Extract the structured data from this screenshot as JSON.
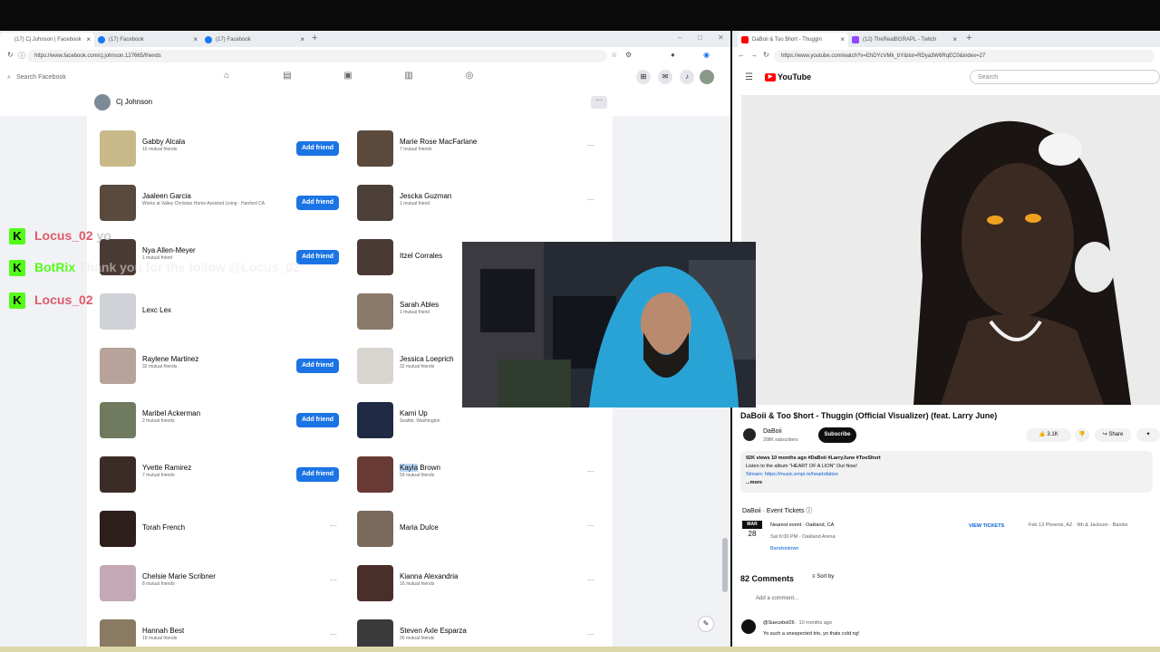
{
  "fb_window": {
    "tabs": [
      {
        "title": "(17) Cj Johnson | Facebook"
      },
      {
        "title": "(17) Facebook"
      },
      {
        "title": "(17) Facebook"
      }
    ],
    "url": "https://www.facebook.com/cj.johnson.127665/friends",
    "search_placeholder": "Search Facebook",
    "profile_name": "Cj Johnson",
    "profile_more": "···",
    "friends_left": [
      {
        "name": "Gabby Alcala",
        "sub": "16 mutual friends",
        "action": "Add friend",
        "color": "#c9b98a"
      },
      {
        "name": "Jaaleen Garcia",
        "sub": "Works at Valley Christian Home Assisted Living · Hanford CA",
        "action": "Add friend",
        "color": "#5a4a3e"
      },
      {
        "name": "Nya Allen-Meyer",
        "sub": "1 mutual friend",
        "action": "Add friend",
        "color": "#4a3a34"
      },
      {
        "name": "Lexc Lex",
        "sub": "",
        "action": "",
        "color": "#cfd2d6"
      },
      {
        "name": "Raylene Martinez",
        "sub": "32 mutual friends",
        "action": "Add friend",
        "color": "#b8a39a"
      },
      {
        "name": "Maribel Ackerman",
        "sub": "2 mutual friends",
        "action": "Add friend",
        "color": "#6f7a5e"
      },
      {
        "name": "Yvette Ramirez",
        "sub": "7 mutual friends",
        "action": "Add friend",
        "color": "#3c2c28"
      },
      {
        "name": "Torah French",
        "sub": "",
        "action": "···",
        "color": "#2e1e1c"
      },
      {
        "name": "Chelsie Marie Scribner",
        "sub": "8 mutual friends",
        "action": "···",
        "color": "#c4a8b5"
      },
      {
        "name": "Hannah Best",
        "sub": "19 mutual friends",
        "action": "···",
        "color": "#8a7a62"
      }
    ],
    "friends_right": [
      {
        "name": "Marie Rose MacFarlane",
        "sub": "7 mutual friends",
        "action": "···",
        "color": "#5b4a3c"
      },
      {
        "name": "Jescka Guzman",
        "sub": "1 mutual friend",
        "action": "···",
        "color": "#4c3f38"
      },
      {
        "name": "Itzel Corrales",
        "sub": "",
        "action": "",
        "color": "#4a3a36"
      },
      {
        "name": "Sarah Ables",
        "sub": "1 mutual friend",
        "action": "",
        "color": "#8a7a6a"
      },
      {
        "name": "Jessica Loeprich",
        "sub": "32 mutual friends",
        "action": "",
        "color": "#d8d4cf"
      },
      {
        "name": "Kami Up",
        "sub": "Seattle, Washington",
        "action": "",
        "color": "#1f2a44"
      },
      {
        "name_highlight": "Kayla",
        "name_rest": " Brown",
        "sub": "59 mutual friends",
        "action": "···",
        "color": "#6a3a34"
      },
      {
        "name": "Maria Dulce",
        "sub": "",
        "action": "···",
        "color": "#7a6a5c"
      },
      {
        "name": "Kianna Alexandria",
        "sub": "16 mutual friends",
        "action": "···",
        "color": "#4a2e2a"
      },
      {
        "name": "Steven Axle Esparza",
        "sub": "55 mutual friends",
        "action": "···",
        "color": "#3a3a3a"
      }
    ]
  },
  "chat_overlay": [
    {
      "user": "Locus_02",
      "msg": "yo",
      "color": "#e05a6a"
    },
    {
      "user": "BotRix",
      "msg": "Thank you for the follow @Locus_02",
      "color": "#53fc18"
    },
    {
      "user": "Locus_02",
      "msg": "",
      "color": "#e05a6a"
    }
  ],
  "yt_window": {
    "tabs": [
      {
        "title": "DaBoii & Too $hort - Thuggin"
      },
      {
        "title": "(12) TheRealBGRAPL - Twitch"
      }
    ],
    "url": "https://www.youtube.com/watch?v=EhDYcVMk_bY&list=RDya3W6RqEC0&index=27",
    "logo": "YouTube",
    "search_placeholder": "Search",
    "video_title": "DaBoii & Too $hort - Thuggin (Official Visualizer) (feat. Larry June)",
    "channel": "DaBoii",
    "subscribers": "208K subscribers",
    "subscribe_label": "Subscribe",
    "likes": "3.1K",
    "share_label": "Share",
    "desc": {
      "meta": "92K views  10 months ago  #DaBoii #LarryJune #TooShort",
      "line1": "Listen to the album \"HEART OF A LION\" Out Now!",
      "line2": "Stream: https://music.empi.re/heartofalion",
      "more": "...more"
    },
    "events": {
      "header": "DaBoii · Event Tickets",
      "month": "MAR",
      "day": "28",
      "title": "Nearest event · Oakland, CA",
      "time": "Sat 6:00 PM · Oakland Arena",
      "vendor": "Bandsintown",
      "tickets_label": "VIEW TICKETS",
      "next": "Feb 13    Phoenix, AZ · 9th & Jackson · Bandsi"
    },
    "comments_count": "82 Comments",
    "sort_label": "Sort by",
    "add_comment": "Add a comment...",
    "comment_user": "@Suecebol26",
    "comment_age": "10 months ago",
    "comment_text": "Yo such a unexpected trio, yo thats cold ng!"
  }
}
